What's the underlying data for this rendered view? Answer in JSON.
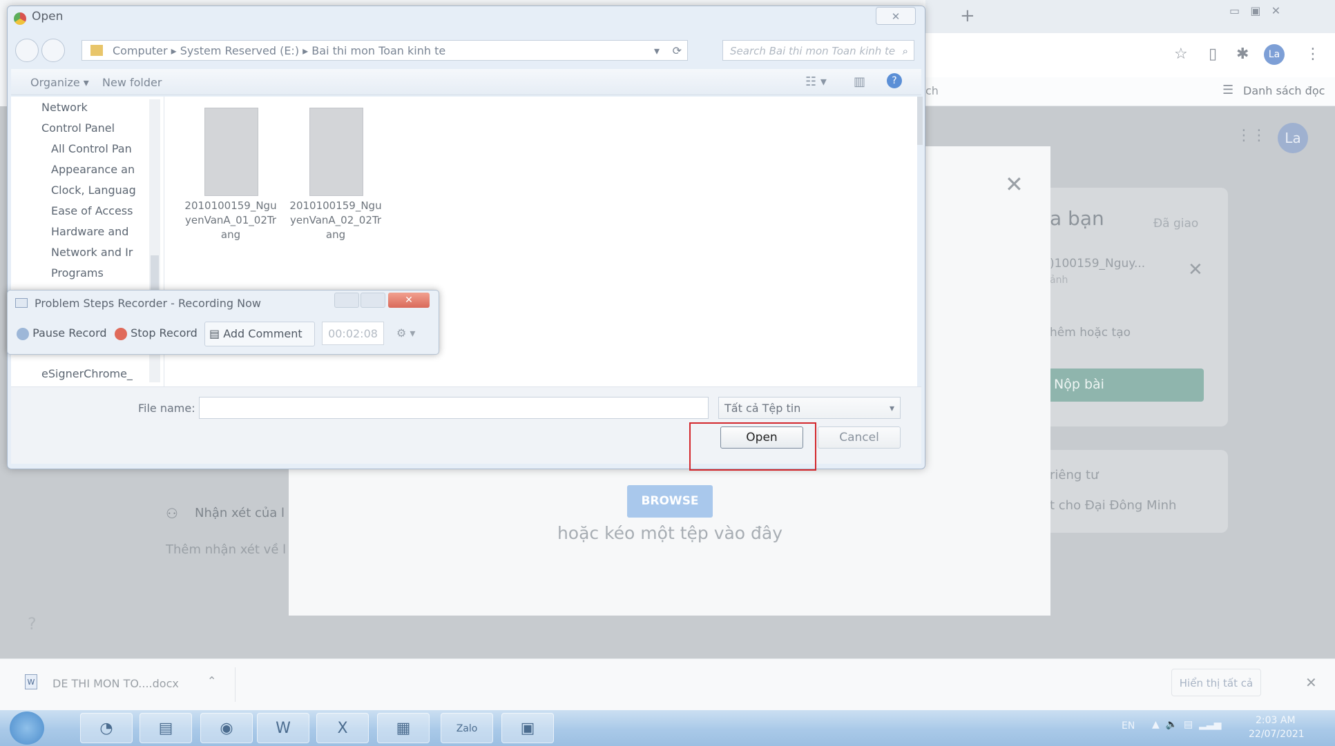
{
  "chrome": {
    "bookmarks_label": "Danh sách đọc",
    "tab_fragment": "ch",
    "avatar": "La"
  },
  "classroom": {
    "panel_title_fragment": "a bạn",
    "panel_status": "Đã giao",
    "attachment_fragment": ")100159_Nguy...",
    "attachment_sub": "ảnh",
    "add_create_fragment": "hêm hoặc tạo",
    "submit_label": "Nộp bài",
    "private_title_fragment": "riêng tư",
    "private_comment_fragment": "t cho Đại Đông Minh",
    "comments_label": "Nhận xét của l",
    "comments_hint": "Thêm nhận xét về l"
  },
  "upload_modal": {
    "browse_label": "BROWSE",
    "drag_text": "hoặc kéo một tệp vào đây"
  },
  "open_dialog": {
    "title": "Open",
    "breadcrumb": [
      "Computer",
      "System Reserved (E:)",
      "Bai thi mon Toan kinh te"
    ],
    "search_placeholder": "Search Bai thi mon Toan kinh te",
    "organize_label": "Organize ▾",
    "new_folder_label": "New folder",
    "nav_items": [
      "Network",
      "Control Panel",
      "All Control Pan",
      "Appearance an",
      "Clock, Languag",
      "Ease of Access",
      "Hardware and",
      "Network and Ir",
      "Programs",
      "eSignerChrome_"
    ],
    "files": [
      {
        "name_line1": "2010100159_Ngu",
        "name_line2": "yenVanA_01_02Tr",
        "name_line3": "ang"
      },
      {
        "name_line1": "2010100159_Ngu",
        "name_line2": "yenVanA_02_02Tr",
        "name_line3": "ang"
      }
    ],
    "filename_label": "File name:",
    "filename_value": "",
    "filetype_value": "Tất cả Tệp tin",
    "open_label": "Open",
    "cancel_label": "Cancel"
  },
  "steps_recorder": {
    "title": "Problem Steps Recorder - Recording Now",
    "pause_label": "Pause Record",
    "stop_label": "Stop Record",
    "comment_label": "Add Comment",
    "timer": "00:02:08"
  },
  "download_bar": {
    "file_label": "DE THI MON TO....docx",
    "show_all_label": "Hiển thị tất cả"
  },
  "taskbar": {
    "language": "EN",
    "time": "2:03 AM",
    "date": "22/07/2021",
    "zalo_label": "Zalo"
  }
}
